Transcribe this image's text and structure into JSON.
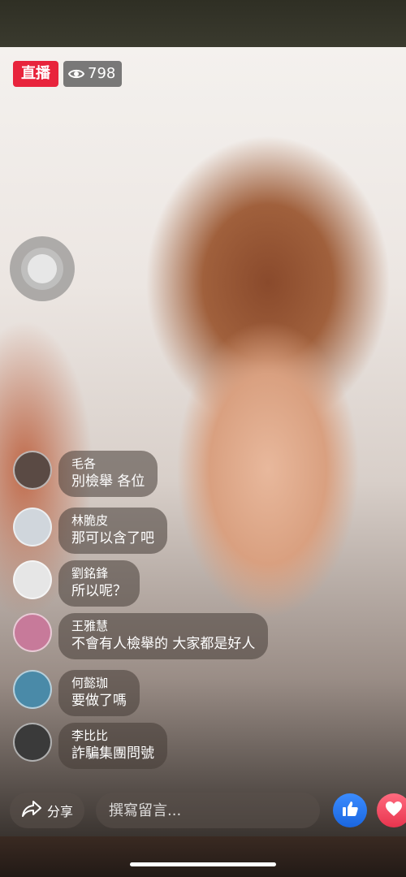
{
  "live": {
    "badge_label": "直播",
    "viewer_count": "798"
  },
  "comments": [
    {
      "name": "毛各",
      "text": "別檢舉 各位",
      "avatar_color": "#5a4a44"
    },
    {
      "name": "林脆皮",
      "text": "那可以含了吧",
      "avatar_color": "#d0d6dc"
    },
    {
      "name": "劉銘鋒",
      "text": "所以呢？",
      "avatar_color": "#e6e6e6"
    },
    {
      "name": "王雅慧",
      "text": "不會有人檢舉的 大家都是好人",
      "avatar_color": "#c77a9a"
    },
    {
      "name": "何懿珈",
      "text": "要做了嗎",
      "avatar_color": "#4a8aa8"
    },
    {
      "name": "李比比",
      "text": "詐騙集團問號",
      "avatar_color": "#3a3a3a"
    }
  ],
  "footer": {
    "share_label": "分享",
    "comment_placeholder": "撰寫留言...",
    "like_color": "#1a66e0",
    "love_color": "#e8344e"
  },
  "icons": {
    "viewer": "eye-icon",
    "share": "share-icon",
    "like": "thumbs-up-icon",
    "love": "heart-icon"
  }
}
